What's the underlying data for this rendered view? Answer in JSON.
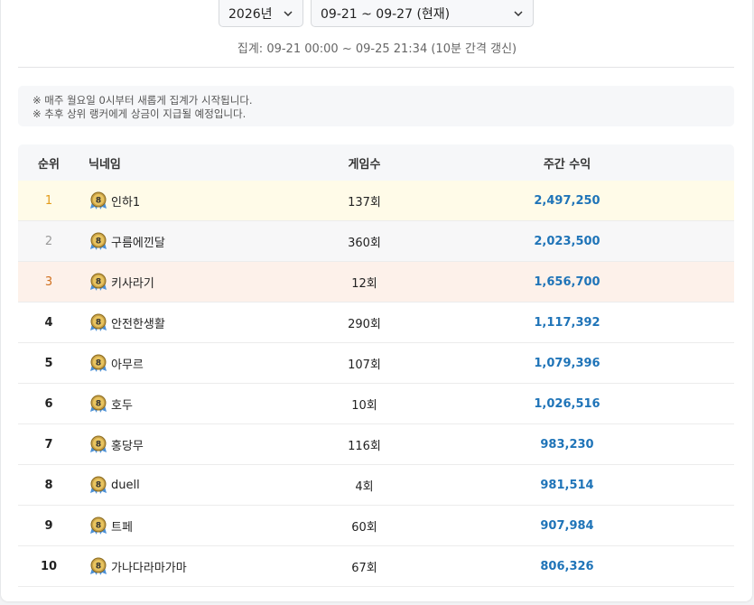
{
  "filters": {
    "year": "2026년",
    "week": "09-21 ~ 09-27 (현재)"
  },
  "period_text": "집계: 09-21 00:00 ~ 09-25 21:34 (10분 간격 갱신)",
  "notices": [
    "※ 매주 월요일 0시부터 새롭게 집계가 시작됩니다.",
    "※ 추후 상위 랭커에게 상금이 지급될 예정입니다."
  ],
  "table": {
    "headers": {
      "rank": "순위",
      "nickname": "닉네임",
      "games": "게임수",
      "earnings": "주간 수익"
    },
    "rows": [
      {
        "rank": "1",
        "nickname": "인하1",
        "games": "137회",
        "earnings": "2,497,250"
      },
      {
        "rank": "2",
        "nickname": "구름에낀달",
        "games": "360회",
        "earnings": "2,023,500"
      },
      {
        "rank": "3",
        "nickname": "키사라기",
        "games": "12회",
        "earnings": "1,656,700"
      },
      {
        "rank": "4",
        "nickname": "안전한생활",
        "games": "290회",
        "earnings": "1,117,392"
      },
      {
        "rank": "5",
        "nickname": "아무르",
        "games": "107회",
        "earnings": "1,079,396"
      },
      {
        "rank": "6",
        "nickname": "호두",
        "games": "10회",
        "earnings": "1,026,516"
      },
      {
        "rank": "7",
        "nickname": "홍당무",
        "games": "116회",
        "earnings": "983,230"
      },
      {
        "rank": "8",
        "nickname": "duell",
        "games": "4회",
        "earnings": "981,514"
      },
      {
        "rank": "9",
        "nickname": "트페",
        "games": "60회",
        "earnings": "907,984"
      },
      {
        "rank": "10",
        "nickname": "가나다라마가마",
        "games": "67회",
        "earnings": "806,326"
      }
    ]
  },
  "badge": {
    "label": "8",
    "icon": "rank-medal-icon"
  },
  "colors": {
    "earnings": "#1f74b8",
    "rank1": "#e39b1a",
    "rank2": "#9a9a9a",
    "rank3": "#d0701e",
    "row1_bg": "#fffbe8",
    "row2_bg": "#f7f7f8",
    "row3_bg": "#fdf1ea"
  }
}
